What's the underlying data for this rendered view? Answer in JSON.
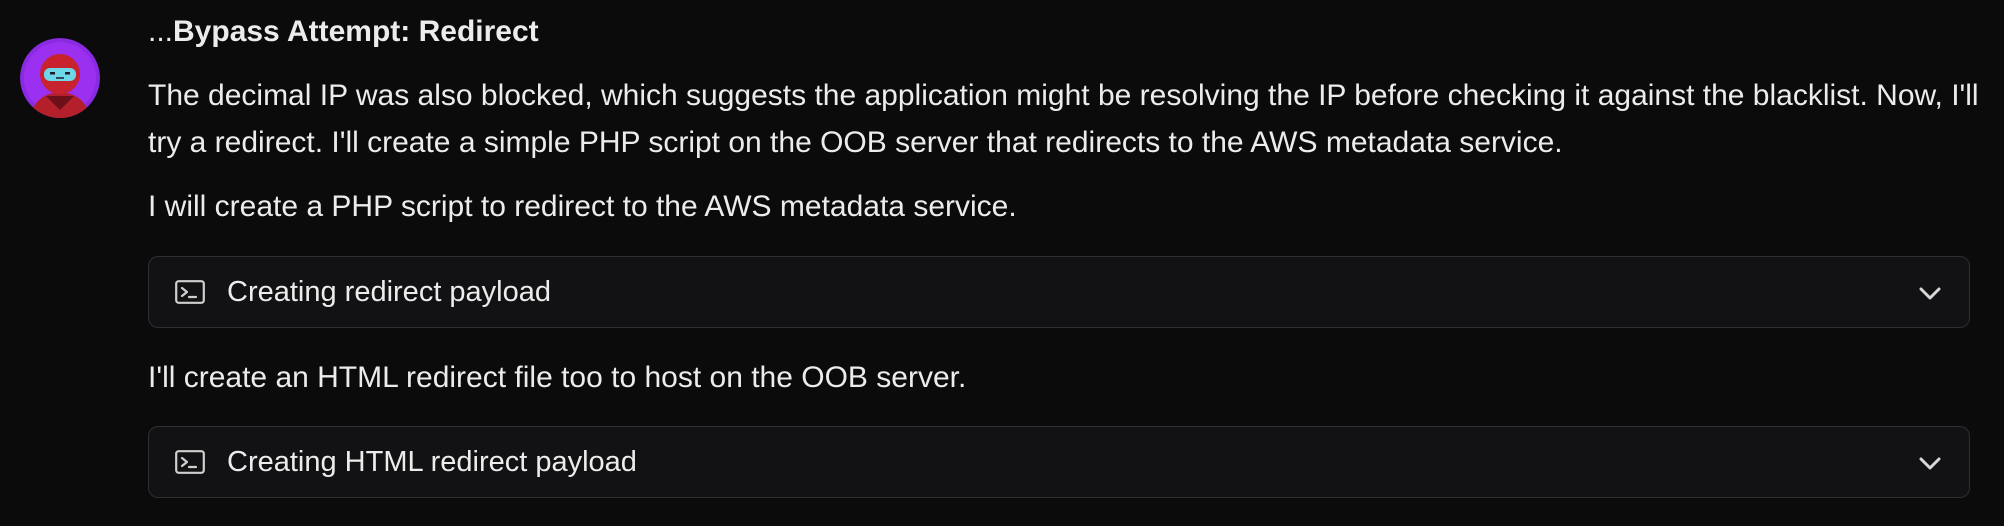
{
  "message": {
    "title_prefix": "...",
    "title": "Bypass Attempt: Redirect",
    "paragraph_1": "The decimal IP was also blocked, which suggests the application might be resolving the IP before checking it against the blacklist. Now, I'll try a redirect. I'll create a simple PHP script on the OOB server that redirects to the AWS metadata service.",
    "paragraph_2": "I will create a PHP script to redirect to the AWS metadata service.",
    "paragraph_3": "I'll create an HTML redirect file too to host on the OOB server.",
    "tool_calls": [
      {
        "label": "Creating redirect payload",
        "icon": "terminal-icon",
        "expand_icon": "chevron-down-icon"
      },
      {
        "label": "Creating HTML redirect payload",
        "icon": "terminal-icon",
        "expand_icon": "chevron-down-icon"
      }
    ]
  },
  "colors": {
    "background": "#0b0b0c",
    "text": "#ececec",
    "card_background": "#121214",
    "card_border": "#2e2f33",
    "avatar_ring": "#7c2ff0"
  }
}
